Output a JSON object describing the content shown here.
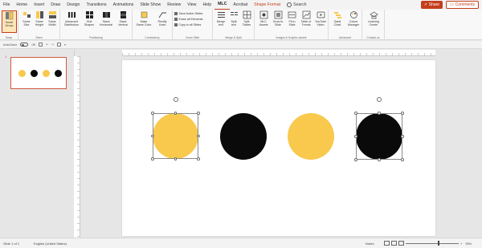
{
  "tabs": [
    {
      "label": "File",
      "active": false
    },
    {
      "label": "Home",
      "active": false
    },
    {
      "label": "Insert",
      "active": false
    },
    {
      "label": "Draw",
      "active": false
    },
    {
      "label": "Design",
      "active": false
    },
    {
      "label": "Transitions",
      "active": false
    },
    {
      "label": "Animations",
      "active": false
    },
    {
      "label": "Slide Show",
      "active": false
    },
    {
      "label": "Review",
      "active": false
    },
    {
      "label": "View",
      "active": false
    },
    {
      "label": "Help",
      "active": false
    },
    {
      "label": "MLC",
      "active": true
    },
    {
      "label": "Acrobat",
      "active": false
    },
    {
      "label": "Shape Format",
      "active": false,
      "contextual": true
    }
  ],
  "search": {
    "label": "Search"
  },
  "share": {
    "label": "Share"
  },
  "comments": {
    "label": "Comments"
  },
  "ribbon": {
    "groups": [
      {
        "label": "Swap"
      },
      {
        "label": "Sizes"
      },
      {
        "label": "Positioning"
      },
      {
        "label": "Consistency"
      },
      {
        "label": "Cross Slide"
      },
      {
        "label": "Merge & Split"
      },
      {
        "label": "Images & Graphic assets"
      },
      {
        "label": "Advanced"
      },
      {
        "label": "Contact us"
      }
    ],
    "buttons": {
      "smart_grid": "Smart\nGroup",
      "same_size": "Same\nSize",
      "same_height": "Same\nHeight",
      "same_width": "Same\nWidth",
      "advanced_distribution": "Advanced\nDistribution",
      "grid_shapes": "Grid\nShapes",
      "stack_horizontal": "Stack\nHorizontal",
      "stack_vertical": "Stack\nVertical",
      "make_same_color": "Make\nSame Color",
      "rectify_lines": "Rectify\nLines",
      "save_action_slides": "Save Action Slides",
      "erase_all_elements": "Erase all Elements",
      "copy_to_all_slides": "Copy to all Slides",
      "merge_text": "Merge\ntext",
      "split_text": "Split\ntext",
      "split_tables": "Split\nTables",
      "mlc_assets": "MLC\nAssets",
      "grow_to_slide": "Grow to\nSlide",
      "fit_to_slide": "Fit to\nSlide",
      "table_of_trends": "Table of\nTrends",
      "youtube_video": "YouTube\nVideo",
      "gantt_chart": "Gantt\nChart",
      "colors_manager": "Colors\nManager",
      "learning_center": "Learning\nCenter"
    }
  },
  "qat": {
    "autosave_label": "AutoSave",
    "autosave_state": "Off"
  },
  "thumbnail": {
    "number": "1"
  },
  "slide": {
    "circles": [
      {
        "name": "circle-1",
        "color": "#f9c94d",
        "selected": true
      },
      {
        "name": "circle-2",
        "color": "#0a0a0a",
        "selected": false
      },
      {
        "name": "circle-3",
        "color": "#f9c94d",
        "selected": false
      },
      {
        "name": "circle-4",
        "color": "#0a0a0a",
        "selected": true
      }
    ]
  },
  "status": {
    "slide_info": "Slide 1 of 1",
    "language": "English (United States)",
    "notes": "Notes",
    "zoom": "78%"
  },
  "colors": {
    "accent": "#c43e1c",
    "yellow": "#f9c94d",
    "black": "#0a0a0a"
  }
}
